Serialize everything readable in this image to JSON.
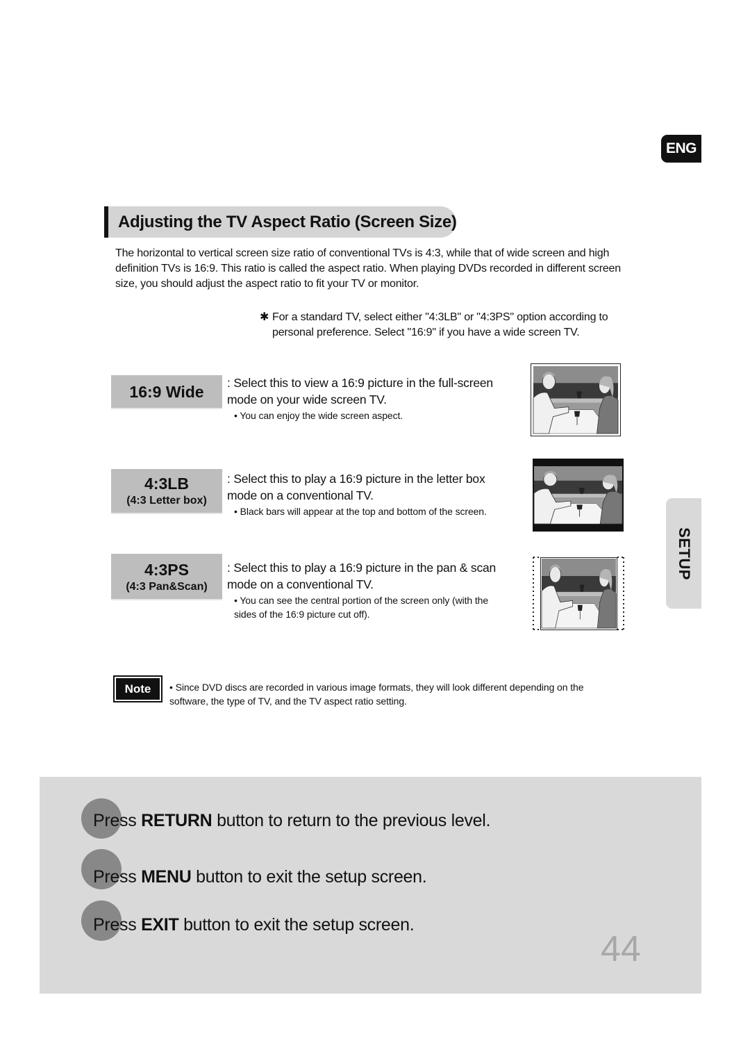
{
  "language_badge": "ENG",
  "section_tab": "SETUP",
  "title": "Adjusting the TV Aspect Ratio (Screen Size)",
  "intro": "The horizontal to vertical screen size ratio of conventional TVs is 4:3, while that of wide screen and high definition TVs is 16:9. This ratio is called the aspect ratio. When playing DVDs recorded in different screen size, you should adjust the aspect ratio to fit your TV or monitor.",
  "tip": {
    "icon": "asterisk-icon",
    "symbol": "✱",
    "text": "For a standard TV, select either \"4:3LB\" or \"4:3PS\" option according to personal preference. Select \"16:9\" if you have a wide screen TV."
  },
  "options": [
    {
      "label": "16:9 Wide",
      "sublabel": "",
      "description": ": Select this to view a 16:9 picture in the full-screen\n  mode on your wide screen TV.",
      "bullet": "• You can enjoy the wide screen aspect.",
      "picture": "wide-screen-picture"
    },
    {
      "label": "4:3LB",
      "sublabel": "(4:3 Letter box)",
      "description": ": Select this to play a 16:9 picture in the letter box\n  mode on a conventional TV.",
      "bullet": "• Black bars will appear at the top and bottom of the screen.",
      "picture": "letterbox-picture"
    },
    {
      "label": "4:3PS",
      "sublabel": "(4:3 Pan&Scan)",
      "description": ": Select this to play a 16:9 picture in the pan & scan\n  mode on a conventional TV.",
      "bullet": "• You can see the central portion of the screen only (with the sides of the 16:9 picture cut off).",
      "picture": "pan-scan-picture"
    }
  ],
  "note": {
    "label": "Note",
    "text": "• Since DVD discs are recorded in various image formats, they will look different depending on the software, the type of TV, and the TV aspect ratio setting."
  },
  "steps": [
    {
      "pre": "Press ",
      "key": "RETURN",
      "post": " button to return to the previous level."
    },
    {
      "pre": "Press ",
      "key": "MENU",
      "post": " button to exit the setup screen."
    },
    {
      "pre": "Press ",
      "key": "EXIT",
      "post": " button to exit the setup screen."
    }
  ],
  "page_number": "44",
  "colors": {
    "label_bg": "#bdbdbd",
    "panel_bg": "#d9d9d9",
    "step_dot": "#888888",
    "page_number": "#a8a8a8"
  }
}
